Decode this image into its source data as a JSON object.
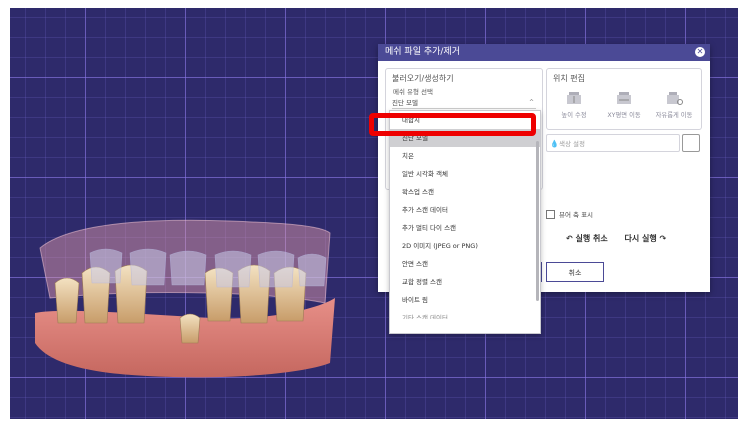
{
  "dialog": {
    "title": "메쉬 파일 추가/제거",
    "load_group": {
      "title": "불러오기/생성하기",
      "type_label": "메쉬 유형 선택",
      "selected_value": "진단 모델"
    },
    "position_group": {
      "title": "위치 편집",
      "tools": [
        {
          "label": "높이 수정",
          "icon": "height-adjust-icon"
        },
        {
          "label": "XY평면 이동",
          "icon": "xy-move-icon"
        },
        {
          "label": "자유롭게 이동",
          "icon": "free-move-icon"
        }
      ]
    },
    "color_label": "색상 설정",
    "viewer_axis_label": "뷰어 축 표시",
    "undo_label": "↶ 실행 취소",
    "redo_label": "다시 실행 ↷",
    "cancel_label": "취소"
  },
  "dropdown": {
    "items": [
      "대합치",
      "진단 모델",
      "치은",
      "일반 시각화 객체",
      "왁스업 스캔",
      "추가 스캔 데이터",
      "추가 멀티 다이 스캔",
      "2D 이미지 (JPEG or PNG)",
      "안면 스캔",
      "교합 정렬 스캔",
      "바이트 림",
      "기타 스캔 데이터"
    ],
    "selected_index": 1,
    "highlighted_index": 0
  },
  "colors": {
    "accent": "#4b4a96",
    "highlight": "#ee0000",
    "grid_background": "#2e2a6b"
  }
}
